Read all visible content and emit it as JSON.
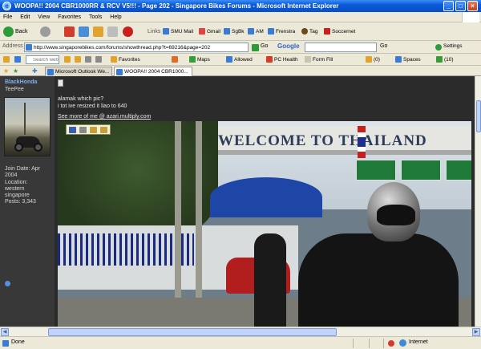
{
  "window": {
    "title": "WOOPA!! 2004 CBR1000RR & RCV V5!!! - Page 202 - Singapore Bikes Forums - Microsoft Internet Explorer",
    "minimize": "_",
    "maximize": "□",
    "close": "×"
  },
  "menu": {
    "items": [
      "File",
      "Edit",
      "View",
      "Favorites",
      "Tools",
      "Help"
    ]
  },
  "toolbar": {
    "back_label": "Back",
    "links_label": "Links",
    "links": [
      "SMU Mail",
      "Gmail",
      "SgBk",
      "AM",
      "Frenstra",
      "Tag",
      "Soccernet"
    ]
  },
  "address": {
    "label": "Address",
    "url": "http://www.singaporebikes.com/forums/showthread.php?t=69216&page=202",
    "go_label": "Go",
    "google_label": "Google",
    "google_search_go": "Go",
    "settings_label": "Settings"
  },
  "google_toolbar": {
    "search_placeholder": "Search web",
    "favorites_label": "Favorites",
    "maps_label": "Maps",
    "allowed_label": "Allowed",
    "pchealth_label": "PC Health",
    "formfill_label": "Form Fill",
    "count1": "(0)",
    "spaces_label": "Spaces",
    "count2": "(10)"
  },
  "tabs": [
    {
      "label": "Microsoft Outlook We...",
      "active": false
    },
    {
      "label": "WOOPA!! 2004 CBR1000...",
      "active": true
    }
  ],
  "post": {
    "username": "BlackHonda",
    "user_title": "TeePee",
    "join_date_label": "Join Date: Apr",
    "join_date_year": "2004",
    "location_label": "Location:",
    "location_line1": "western",
    "location_line2": "singapore",
    "posts_label": "Posts: 3,343",
    "line1": "alamak which pic?",
    "line2": "i tot ive resized it liao to 640",
    "signature": "See more of me @ azari.multiply.com",
    "photo_text": "WELCOME TO THAILAND"
  },
  "status": {
    "text": "Done",
    "zone": "Internet"
  },
  "colors": {
    "titlebar": "#0a5ad8",
    "username": "#7fb2f0",
    "page_bg": "#2b2b2b"
  }
}
